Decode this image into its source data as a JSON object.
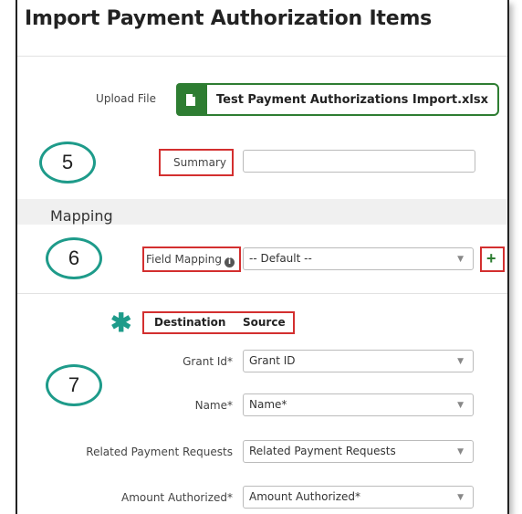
{
  "page": {
    "title": "Import Payment Authorization Items"
  },
  "upload": {
    "label": "Upload File",
    "file_name": "Test Payment Authorizations Import.xlsx"
  },
  "callouts": [
    "5",
    "6",
    "7"
  ],
  "summary": {
    "label": "Summary",
    "value": ""
  },
  "mapping": {
    "section_title": "Mapping",
    "field_mapping_label": "Field Mapping",
    "field_mapping_value": "-- Default --",
    "add_symbol": "+"
  },
  "table": {
    "destination_header": "Destination",
    "source_header": "Source",
    "rows": [
      {
        "destination": "Grant Id*",
        "source": "Grant ID"
      },
      {
        "destination": "Name*",
        "source": "Name*"
      },
      {
        "destination": "Related Payment Requests",
        "source": "Related Payment Requests"
      },
      {
        "destination": "Amount Authorized*",
        "source": "Amount Authorized*"
      }
    ]
  },
  "colors": {
    "accent_green": "#2e7d32",
    "callout_teal": "#1e9b8a",
    "highlight_red": "#d32f2f"
  }
}
